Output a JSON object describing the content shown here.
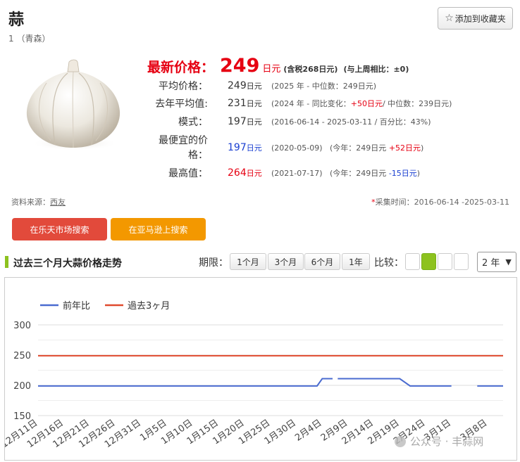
{
  "product": {
    "title": "蒜",
    "subtitle": "1 （青森）",
    "favorite_label": "添加到收藏夹",
    "image_alt": "garlic"
  },
  "price": {
    "latest_label": "最新价格：",
    "latest_value": "249",
    "unit": "日元",
    "tax_note": "(含税268日元)",
    "weekly_compare": "(与上周相比：±0)"
  },
  "stats": [
    {
      "label": "平均价格：",
      "value": "249",
      "unit": "日元",
      "note": "(2025 年 - 中位数：249日元)"
    },
    {
      "label": "去年平均值:",
      "value": "231",
      "unit": "日元",
      "note_pre": "(2024 年 - 同比变化：",
      "note_red": "+50日元",
      "note_post": "/ 中位数：239日元)"
    },
    {
      "label": "模式：",
      "value": "197",
      "unit": "日元",
      "note": "(2016-06-14 - 2025-03-11 / 百分比：43%)"
    },
    {
      "label_line1": "最便宜的价",
      "label_line2": "格：",
      "value": "197",
      "unit": "日元",
      "note_date": "(2020-05-09)",
      "note_pre": "(今年：249日元 ",
      "note_red": "+52日元",
      "note_post": ")"
    },
    {
      "label": "最高值：",
      "value": "264",
      "unit": "日元",
      "note_date": "(2021-07-17)",
      "note_pre": "(今年：249日元 ",
      "note_blue": "-15日元",
      "note_post": ")"
    }
  ],
  "source": {
    "label": "资料来源：",
    "name": "西友"
  },
  "collect": {
    "asterisk": "*",
    "text": "采集时间：2016-06-14 -2025-03-11"
  },
  "buttons": {
    "rakuten": "在乐天市场搜索",
    "amazon": "在亚马逊上搜索"
  },
  "trend": {
    "title": "过去三个月大蒜价格走势",
    "period_label": "期限：",
    "periods": [
      "1个月",
      "3个月",
      "6个月",
      "1年"
    ],
    "compare_label": "比较：",
    "year_select": "2 年",
    "colors": {
      "accent": "#8dc21f",
      "red": "#e60012",
      "blue": "#1a3fd1",
      "orange": "#f39800"
    }
  },
  "chart_data": {
    "type": "line",
    "legend": [
      "前年比",
      "過去3ヶ月"
    ],
    "legend_placement": "top-left",
    "ylim": [
      150,
      300
    ],
    "yticks": [
      300,
      250,
      200,
      150
    ],
    "grid": true,
    "x": [
      "12月11日",
      "12月16日",
      "12月21日",
      "12月26日",
      "12月31日",
      "1月5日",
      "1月10日",
      "1月15日",
      "1月20日",
      "1月25日",
      "1月30日",
      "2月4日",
      "2月9日",
      "2月14日",
      "2月19日",
      "2月24日",
      "3月1日",
      "3月8日"
    ],
    "series": [
      {
        "name": "前年比",
        "color": "#4a6bd0",
        "segments": [
          [
            [
              "12月11日",
              199
            ],
            [
              "2月3日",
              199
            ],
            [
              "2月4日",
              211
            ],
            [
              "2月6日",
              211
            ]
          ],
          [
            [
              "2月7日",
              211
            ],
            [
              "2月19日",
              211
            ],
            [
              "2月21日",
              199
            ],
            [
              "3月1日",
              199
            ]
          ],
          [
            [
              "3月6日",
              199
            ],
            [
              "3月11日",
              199
            ]
          ]
        ]
      },
      {
        "name": "過去3ヶ月",
        "color": "#e04a2e",
        "segments": [
          [
            [
              "12月11日",
              249
            ],
            [
              "3月11日",
              249
            ]
          ]
        ]
      }
    ]
  },
  "watermark": "公众号 · 丰蒜网"
}
